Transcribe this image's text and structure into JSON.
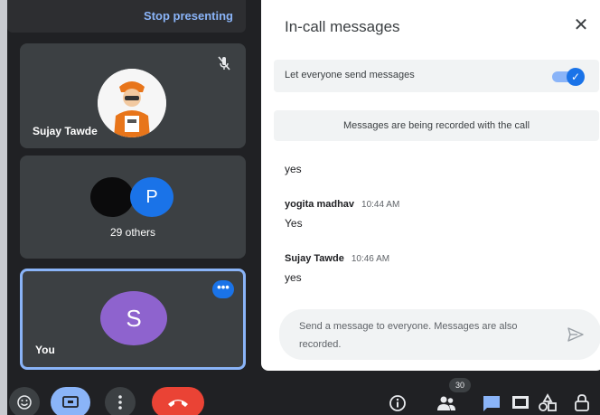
{
  "presenting": {
    "stop_label": "Stop presenting"
  },
  "tiles": [
    {
      "name": "Sujay Tawde"
    },
    {
      "name": "29 others",
      "initial": "P"
    },
    {
      "name": "You",
      "initial": "S"
    }
  ],
  "panel": {
    "title": "In-call messages",
    "allow_messages_label": "Let everyone send messages",
    "allow_messages_on": true,
    "recorded_note": "Messages are being recorded with the call",
    "messages": [
      {
        "sender": "",
        "time": "",
        "text": "yes"
      },
      {
        "sender": "yogita madhav",
        "time": "10:44 AM",
        "text": "Yes"
      },
      {
        "sender": "Sujay Tawde",
        "time": "10:46 AM",
        "text": "yes"
      }
    ],
    "composer_placeholder": "Send a message to everyone. Messages are also recorded."
  },
  "bottom_bar": {
    "participant_count": "30"
  },
  "colors": {
    "background": "#202124",
    "tile": "#3c4043",
    "accent_blue": "#1a73e8",
    "light_blue": "#8ab4f8",
    "leave_red": "#ea4335",
    "you_avatar": "#8e63ce"
  }
}
